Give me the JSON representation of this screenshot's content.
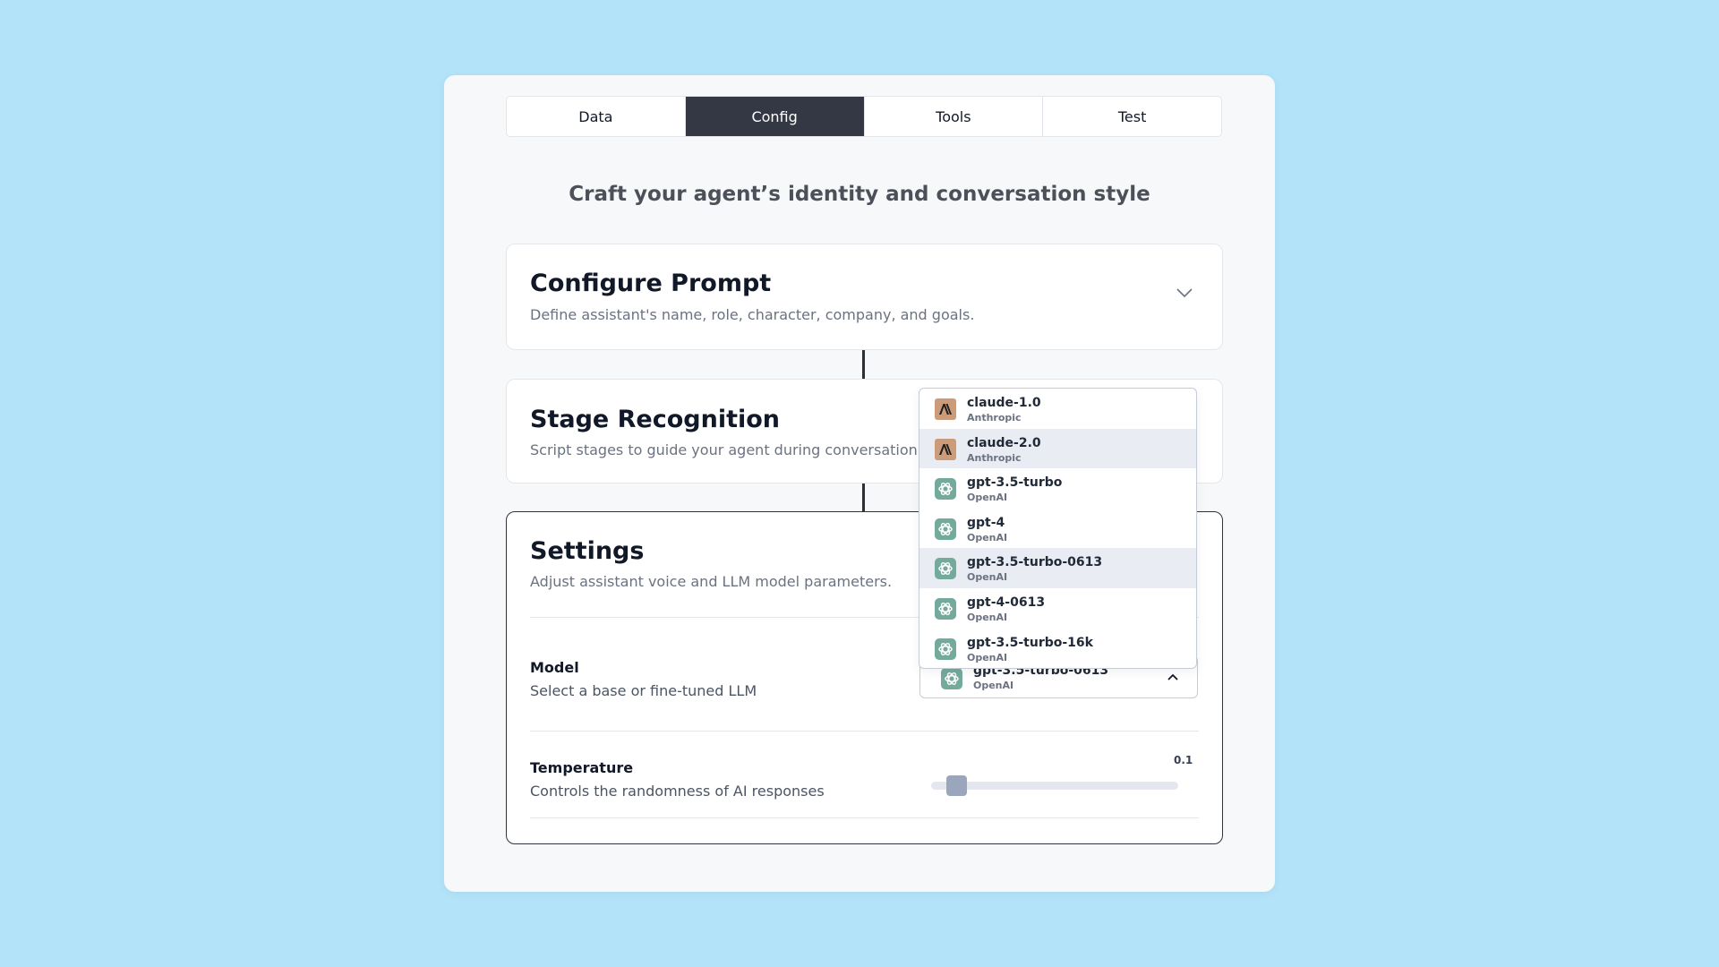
{
  "tabs": [
    {
      "label": "Data"
    },
    {
      "label": "Config",
      "active": true
    },
    {
      "label": "Tools"
    },
    {
      "label": "Test"
    }
  ],
  "subtitle": "Craft your agent’s identity and conversation style",
  "cards": {
    "prompt": {
      "title": "Configure Prompt",
      "desc": "Define assistant's name, role, character, company, and goals."
    },
    "stage": {
      "title": "Stage Recognition",
      "desc": "Script stages to guide your agent during conversation."
    },
    "settings": {
      "title": "Settings",
      "desc": "Adjust assistant voice and LLM model parameters."
    }
  },
  "model": {
    "label": "Model",
    "sublabel": "Select a base or fine-tuned LLM",
    "selected": {
      "name": "gpt-3.5-turbo-0613",
      "provider": "OpenAI",
      "icon": "openai-icon"
    },
    "options": [
      {
        "name": "claude-1.0",
        "provider": "Anthropic",
        "icon": "anthropic-icon"
      },
      {
        "name": "claude-2.0",
        "provider": "Anthropic",
        "icon": "anthropic-icon",
        "highlighted": true
      },
      {
        "name": "gpt-3.5-turbo",
        "provider": "OpenAI",
        "icon": "openai-icon"
      },
      {
        "name": "gpt-4",
        "provider": "OpenAI",
        "icon": "openai-icon"
      },
      {
        "name": "gpt-3.5-turbo-0613",
        "provider": "OpenAI",
        "icon": "openai-icon",
        "highlighted": true
      },
      {
        "name": "gpt-4-0613",
        "provider": "OpenAI",
        "icon": "openai-icon"
      },
      {
        "name": "gpt-3.5-turbo-16k",
        "provider": "OpenAI",
        "icon": "openai-icon"
      }
    ]
  },
  "temperature": {
    "label": "Temperature",
    "sublabel": "Controls the randomness of AI responses",
    "value": "0.1",
    "fraction": 0.1
  },
  "colors": {
    "background": "#b3e3f9",
    "active_tab": "#343845",
    "anthropic": "#cc9b7a",
    "openai": "#74aa9c"
  }
}
